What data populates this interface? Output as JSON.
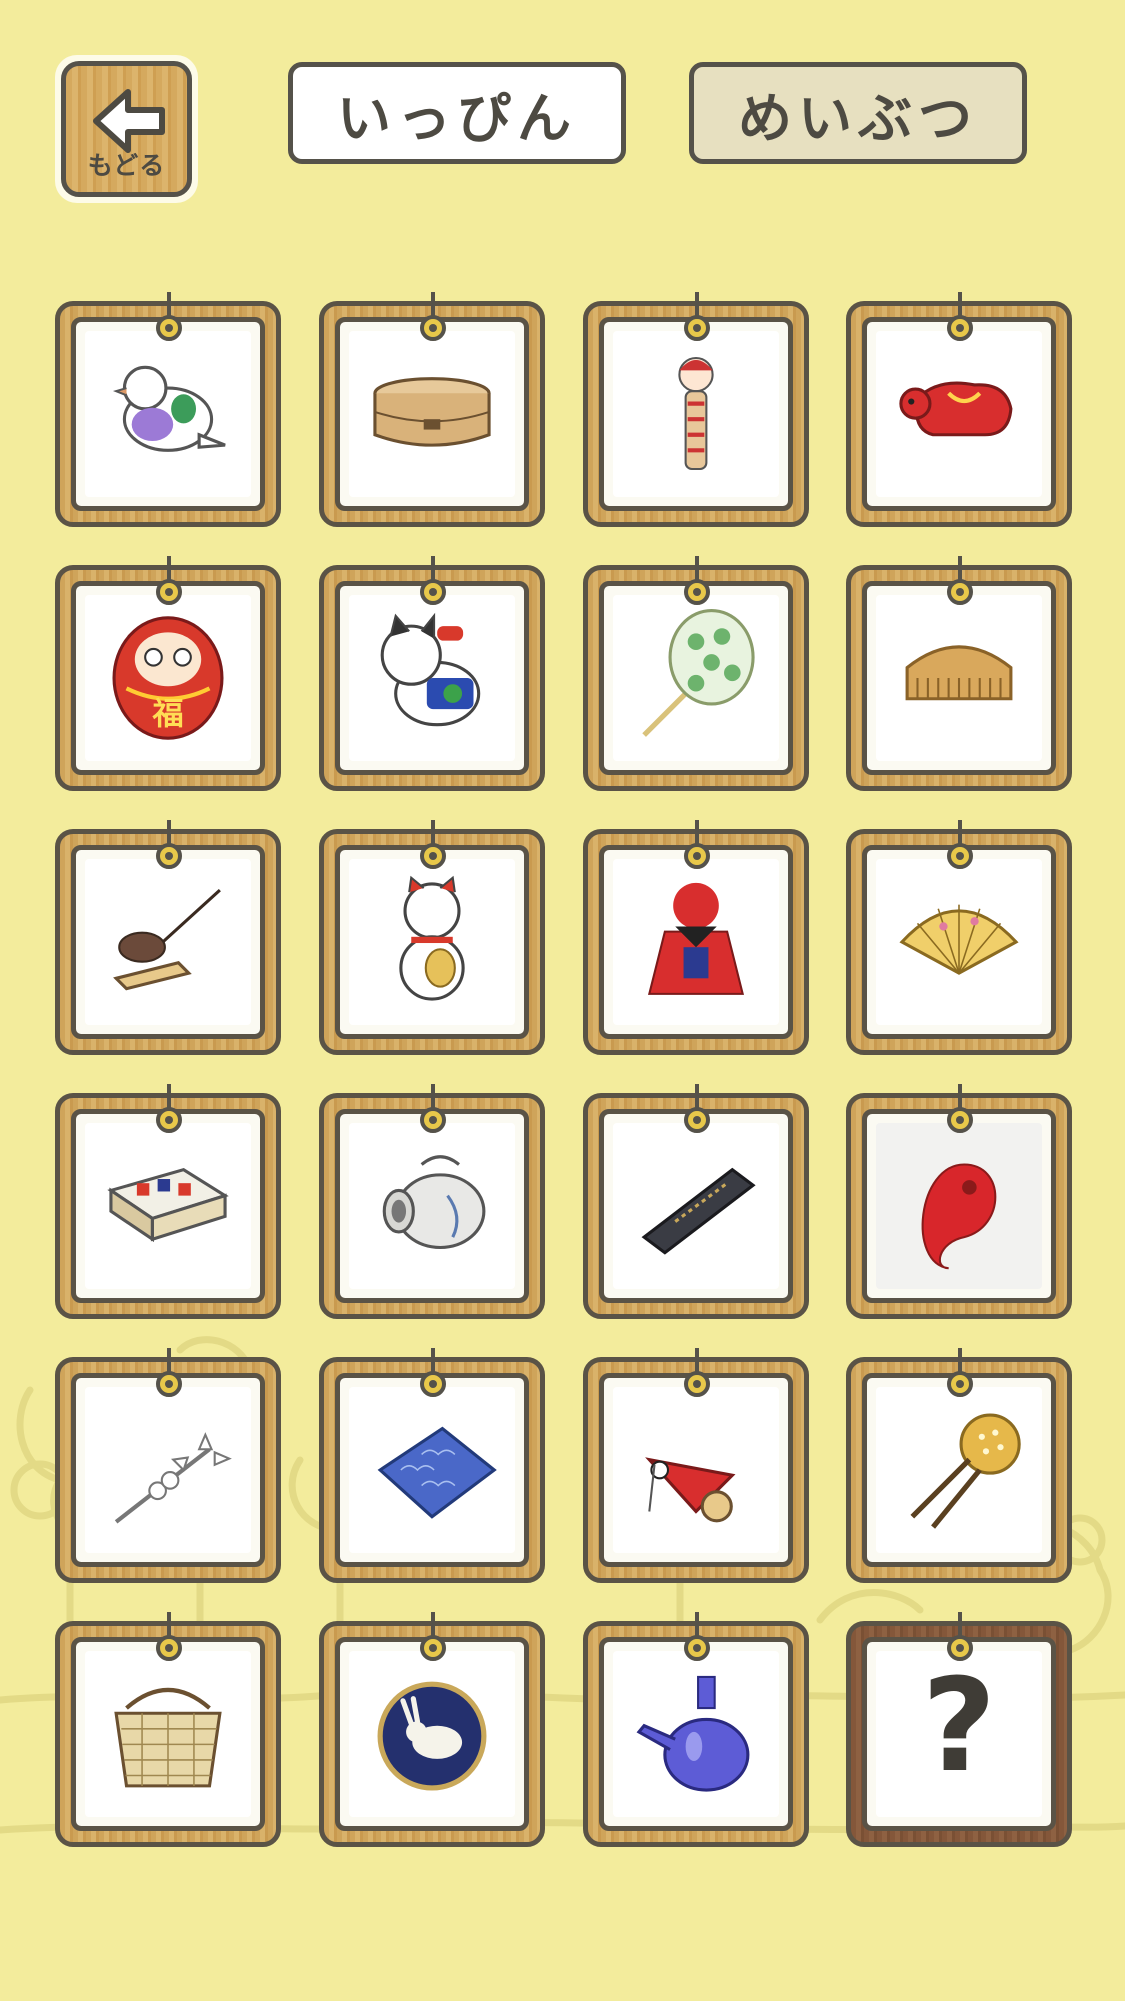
{
  "header": {
    "back_label": "もどる",
    "tabs": [
      {
        "label": "いっぴん",
        "selected": true
      },
      {
        "label": "めいぶつ",
        "selected": false
      }
    ]
  },
  "items": [
    {
      "id": "pigeon-whistle-icon"
    },
    {
      "id": "bento-box-icon"
    },
    {
      "id": "kokeshi-doll-icon"
    },
    {
      "id": "akabeko-cow-icon"
    },
    {
      "id": "daruma-icon",
      "text": "福"
    },
    {
      "id": "inu-hariko-dog-icon"
    },
    {
      "id": "uchiwa-fan-icon"
    },
    {
      "id": "wooden-comb-icon"
    },
    {
      "id": "mousetrap-icon"
    },
    {
      "id": "maneki-neko-icon"
    },
    {
      "id": "sarubobo-doll-icon"
    },
    {
      "id": "folding-fan-icon"
    },
    {
      "id": "matchbox-icon"
    },
    {
      "id": "mosquito-pig-icon"
    },
    {
      "id": "ink-stick-icon"
    },
    {
      "id": "magatama-icon",
      "grey": true
    },
    {
      "id": "pearl-hairpin-icon"
    },
    {
      "id": "furoshiki-cloth-icon"
    },
    {
      "id": "koi-streamer-toy-icon"
    },
    {
      "id": "kanzashi-hairpin-icon"
    },
    {
      "id": "woven-basket-icon"
    },
    {
      "id": "rabbit-plate-icon"
    },
    {
      "id": "sake-bottle-icon"
    },
    {
      "id": "locked-question-icon",
      "locked": true,
      "text": "?"
    }
  ],
  "colors": {
    "background": "#f3ec9c",
    "frame_wood": "#d5a95e",
    "frame_dark_wood": "#84573a",
    "outline": "#55524a"
  }
}
